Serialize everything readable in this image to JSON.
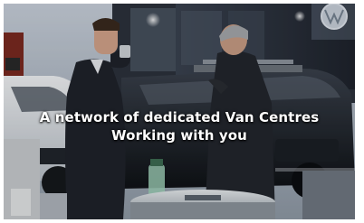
{
  "caption": {
    "line1": "A network of dedicated Van Centres",
    "line2": "Working with you"
  },
  "icons": [
    "brand-emblem-icon"
  ]
}
